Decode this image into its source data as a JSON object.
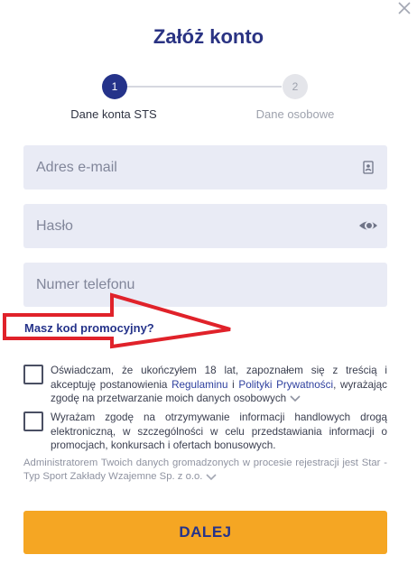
{
  "modal": {
    "title": "Załóż konto",
    "close_icon": "close-icon"
  },
  "steps": [
    {
      "number": "1",
      "label": "Dane konta STS",
      "active": true
    },
    {
      "number": "2",
      "label": "Dane osobowe",
      "active": false
    }
  ],
  "fields": {
    "email": {
      "placeholder": "Adres e-mail",
      "value": "",
      "icon": "contact-card-icon"
    },
    "password": {
      "placeholder": "Hasło",
      "value": "",
      "icon": "eye-icon"
    },
    "phone": {
      "placeholder": "Numer telefonu",
      "value": ""
    }
  },
  "promo_link": "Masz kod promocyjny?",
  "annotation": {
    "icon": "red-arrow-icon",
    "color": "#e0222a"
  },
  "consents": [
    {
      "checked": false,
      "text_before": "Oświadczam, że ukończyłem 18 lat, zapoznałem się z treścią i akceptuję postanowienia ",
      "link1": "Regulaminu",
      "text_mid": " i ",
      "link2": "Polityki Prywatności",
      "text_after": ", wyrażając zgodę na przetwarzanie moich danych osobowych"
    },
    {
      "checked": false,
      "text": "Wyrażam zgodę na otrzymywanie informacji handlowych drogą elektroniczną, w szczególności w celu przedstawiania informacji o promocjach, konkursach i ofertach bonusowych."
    }
  ],
  "admin_note": "Administratorem Twoich danych gromadzonych w procesie rejestracji jest Star -Typ Sport Zakłady Wzajemne Sp. z o.o.",
  "submit_label": "DALEJ",
  "colors": {
    "brand_navy": "#25338a",
    "accent_orange": "#f5a623",
    "field_bg": "#e9ebf5"
  }
}
